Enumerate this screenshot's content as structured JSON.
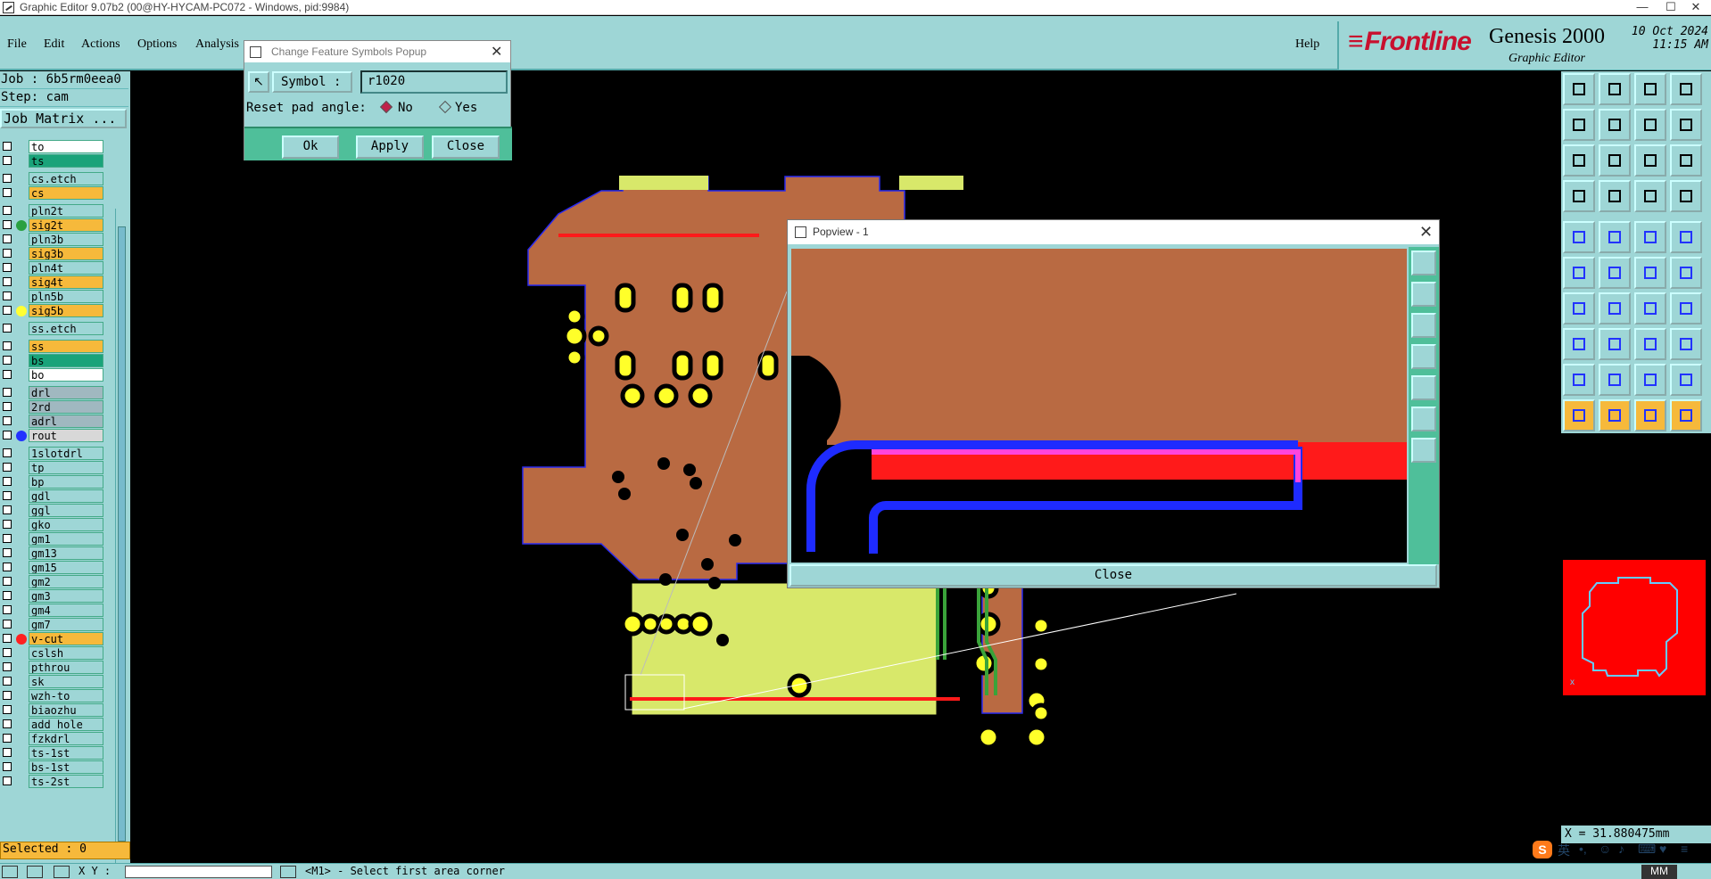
{
  "window": {
    "title": "Graphic Editor 9.07b2 (00@HY-HYCAM-PC072 - Windows, pid:9984)",
    "controls": [
      "—",
      "☐",
      "✕"
    ]
  },
  "menubar": {
    "items": [
      "File",
      "Edit",
      "Actions",
      "Options",
      "Analysis"
    ],
    "help": "Help"
  },
  "brand": {
    "logo_text": "Frontline",
    "product": "Genesis 2000",
    "subtitle": "Graphic Editor",
    "date": "10 Oct 2024",
    "time": "11:15 AM"
  },
  "left_panel": {
    "job": "Job : 6b5rm0eea0",
    "step": "Step: cam",
    "job_matrix": "Job Matrix ..."
  },
  "layers": [
    {
      "name": "to",
      "color": "#ffffff",
      "dot": ""
    },
    {
      "name": "ts",
      "color": "#1aa37a",
      "dot": ""
    },
    {
      "name": "cs.etch",
      "color": "#9ed6d6",
      "dot": ""
    },
    {
      "name": "cs",
      "color": "#f6b93b",
      "dot": ""
    },
    {
      "name": "pln2t",
      "color": "#9ed6d6",
      "dot": ""
    },
    {
      "name": "sig2t",
      "color": "#f6b93b",
      "dot": "#2aa040"
    },
    {
      "name": "pln3b",
      "color": "#9ed6d6",
      "dot": ""
    },
    {
      "name": "sig3b",
      "color": "#f6b93b",
      "dot": ""
    },
    {
      "name": "pln4t",
      "color": "#9ed6d6",
      "dot": ""
    },
    {
      "name": "sig4t",
      "color": "#f6b93b",
      "dot": ""
    },
    {
      "name": "pln5b",
      "color": "#9ed6d6",
      "dot": ""
    },
    {
      "name": "sig5b",
      "color": "#f6b93b",
      "dot": "#ffff33"
    },
    {
      "name": "ss.etch",
      "color": "#9ed6d6",
      "dot": ""
    },
    {
      "name": "ss",
      "color": "#f6b93b",
      "dot": ""
    },
    {
      "name": "bs",
      "color": "#1aa37a",
      "dot": ""
    },
    {
      "name": "bo",
      "color": "#ffffff",
      "dot": ""
    },
    {
      "name": "drl",
      "color": "#a0b8c0",
      "dot": ""
    },
    {
      "name": "2rd",
      "color": "#a0b8c0",
      "dot": ""
    },
    {
      "name": "adrl",
      "color": "#a0b8c0",
      "dot": ""
    },
    {
      "name": "rout",
      "color": "#d8d8d8",
      "dot": "#2233ff"
    },
    {
      "name": "1slotdrl",
      "color": "#9ed6d6",
      "dot": ""
    },
    {
      "name": "tp",
      "color": "#9ed6d6",
      "dot": ""
    },
    {
      "name": "bp",
      "color": "#9ed6d6",
      "dot": ""
    },
    {
      "name": "gdl",
      "color": "#9ed6d6",
      "dot": ""
    },
    {
      "name": "ggl",
      "color": "#9ed6d6",
      "dot": ""
    },
    {
      "name": "gko",
      "color": "#9ed6d6",
      "dot": ""
    },
    {
      "name": "gm1",
      "color": "#9ed6d6",
      "dot": ""
    },
    {
      "name": "gm13",
      "color": "#9ed6d6",
      "dot": ""
    },
    {
      "name": "gm15",
      "color": "#9ed6d6",
      "dot": ""
    },
    {
      "name": "gm2",
      "color": "#9ed6d6",
      "dot": ""
    },
    {
      "name": "gm3",
      "color": "#9ed6d6",
      "dot": ""
    },
    {
      "name": "gm4",
      "color": "#9ed6d6",
      "dot": ""
    },
    {
      "name": "gm7",
      "color": "#9ed6d6",
      "dot": ""
    },
    {
      "name": "v-cut",
      "color": "#f6b93b",
      "dot": "#ff2020"
    },
    {
      "name": "cslsh",
      "color": "#9ed6d6",
      "dot": ""
    },
    {
      "name": "pthrou",
      "color": "#9ed6d6",
      "dot": ""
    },
    {
      "name": "sk",
      "color": "#9ed6d6",
      "dot": ""
    },
    {
      "name": "wzh-to",
      "color": "#9ed6d6",
      "dot": ""
    },
    {
      "name": "biaozhu",
      "color": "#9ed6d6",
      "dot": ""
    },
    {
      "name": "add_hole",
      "color": "#9ed6d6",
      "dot": ""
    },
    {
      "name": "fzkdrl",
      "color": "#9ed6d6",
      "dot": ""
    },
    {
      "name": "ts-1st",
      "color": "#9ed6d6",
      "dot": ""
    },
    {
      "name": "bs-1st",
      "color": "#9ed6d6",
      "dot": ""
    },
    {
      "name": "ts-2st",
      "color": "#9ed6d6",
      "dot": ""
    }
  ],
  "selected": "Selected : 0",
  "symbol_popup": {
    "title": "Change Feature Symbols Popup",
    "symbol_label": "Symbol :",
    "symbol_value": "r1020",
    "reset_label": "Reset pad angle:",
    "opt_no": "No",
    "opt_yes": "Yes",
    "ok": "Ok",
    "apply": "Apply",
    "close": "Close"
  },
  "popview": {
    "title": "Popview - 1",
    "close": "Close"
  },
  "coords": {
    "x": "X = 31.880475mm"
  },
  "bottom": {
    "x_label": "X Y :",
    "status": "<M1> - Select first area corner",
    "units": "MM"
  },
  "ime": "英"
}
